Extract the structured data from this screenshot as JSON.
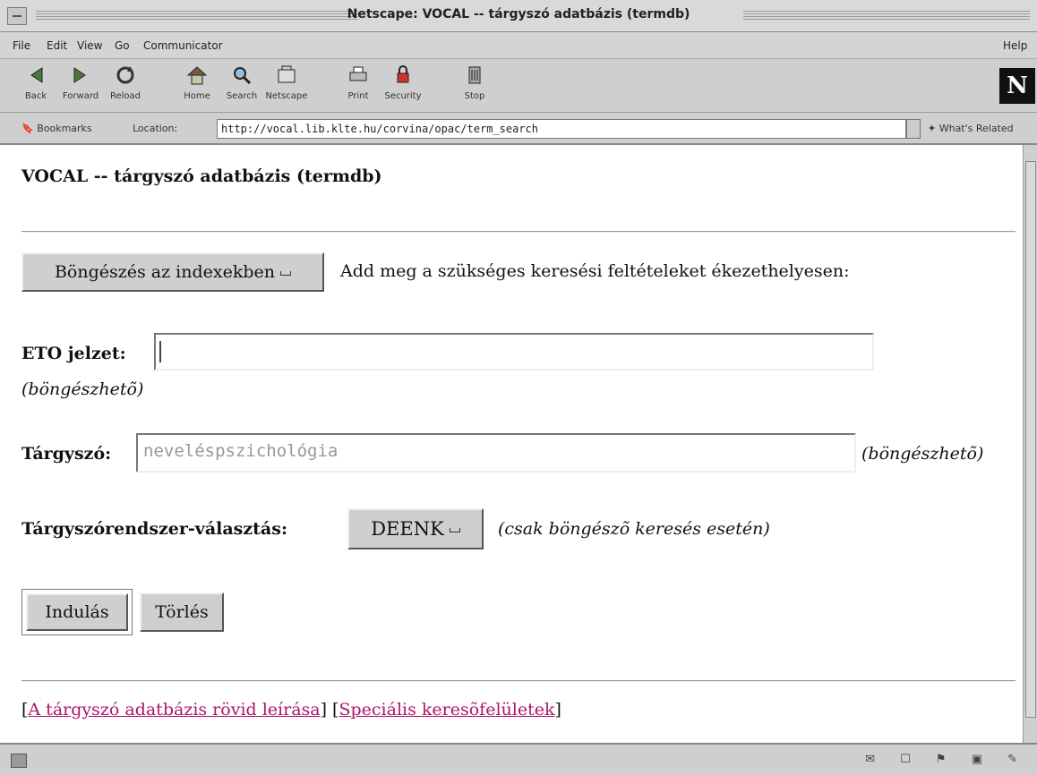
{
  "window": {
    "title": "Netscape: VOCAL -- tárgyszó adatbázis (termdb)"
  },
  "menu": {
    "file": "File",
    "edit": "Edit",
    "view": "View",
    "go": "Go",
    "communicator": "Communicator",
    "help": "Help"
  },
  "toolbar": {
    "back": "Back",
    "forward": "Forward",
    "reload": "Reload",
    "home": "Home",
    "search": "Search",
    "netscape": "Netscape",
    "print": "Print",
    "security": "Security",
    "stop": "Stop",
    "logo": "N"
  },
  "location": {
    "bookmarks": "Bookmarks",
    "label": "Location:",
    "url": "http://vocal.lib.klte.hu/corvina/opac/term_search",
    "related": "What's Related"
  },
  "page": {
    "heading": "VOCAL -- tárgyszó adatbázis (termdb)",
    "browse_button": "Böngészés az indexekben",
    "instruction": "Add meg a szükséges keresési feltételeket ékezethelyesen:",
    "eto_label": "ETO jelzet:",
    "eto_value": "",
    "eto_note": "(böngészhetõ)",
    "subject_label": "Tárgyszó:",
    "subject_placeholder": "neveléspszichológia",
    "subject_note": "(böngészhetõ)",
    "system_label": "Tárgyszórendszer-választás:",
    "system_value": "DEENK",
    "system_note": "(csak böngészõ keresés esetén)",
    "start_button": "Indulás",
    "clear_button": "Törlés",
    "link_description": "A tárgyszó adatbázis rövid leírása",
    "link_special": "Speciális keresõfelületek"
  }
}
